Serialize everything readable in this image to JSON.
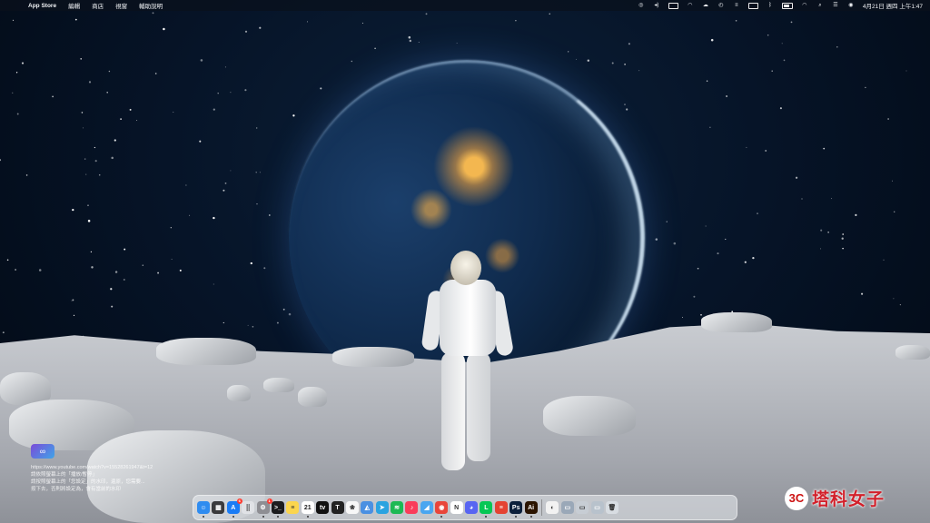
{
  "menubar": {
    "app_name": "App Store",
    "menus": [
      "編輯",
      "商店",
      "視窗",
      "輔助說明"
    ],
    "status_icons": [
      "ring-icon",
      "volume-icon",
      "display-icon",
      "headphones-icon",
      "cloud-icon",
      "timer-icon",
      "menu-icon",
      "battery-info-icon",
      "bluetooth-icon",
      "wifi-icon",
      "control-center-icon",
      "user-icon"
    ],
    "datetime": "4月21日 週四 上午1:47"
  },
  "notice": {
    "lines": [
      "https://www.youtube.com/watch?v=15528261947&t=12",
      "請依照螢幕上的「播放/暫停」",
      "請按照螢幕上的「您設定」的水印，還原，您需要...",
      "按下去，否則將設定為，會有當前的水印"
    ]
  },
  "dock": {
    "items": [
      {
        "name": "finder",
        "glyph": "☺",
        "color": "#2f8cf0"
      },
      {
        "name": "calculator",
        "glyph": "▦",
        "color": "#3a3a3c"
      },
      {
        "name": "app-store",
        "glyph": "A",
        "color": "#1a7cf5",
        "badge": "6"
      },
      {
        "name": "launchpad",
        "glyph": "⣿",
        "color": "#e0e2e6"
      },
      {
        "name": "system-preferences",
        "glyph": "⚙",
        "color": "#8e8e93",
        "badge": "1"
      },
      {
        "name": "terminal",
        "glyph": ">_",
        "color": "#1c1c1e"
      },
      {
        "name": "notes",
        "glyph": "≡",
        "color": "#fbd54e"
      },
      {
        "name": "calendar",
        "glyph": "21",
        "color": "#ffffff"
      },
      {
        "name": "apple-tv",
        "glyph": "tv",
        "color": "#111111"
      },
      {
        "name": "stocks-app",
        "glyph": "T",
        "color": "#222222"
      },
      {
        "name": "photos",
        "glyph": "❀",
        "color": "#f7f7f7"
      },
      {
        "name": "safari-alt",
        "glyph": "◭",
        "color": "#4a90e2"
      },
      {
        "name": "telegram",
        "glyph": "➤",
        "color": "#2aa3e0"
      },
      {
        "name": "spotify",
        "glyph": "≋",
        "color": "#1db954"
      },
      {
        "name": "music",
        "glyph": "♪",
        "color": "#fa3c5a"
      },
      {
        "name": "maps",
        "glyph": "◢",
        "color": "#4aa6f0"
      },
      {
        "name": "chrome",
        "glyph": "◉",
        "color": "#e9453a"
      },
      {
        "name": "notion",
        "glyph": "N",
        "color": "#ffffff"
      },
      {
        "name": "discord",
        "glyph": "◕",
        "color": "#5865f2"
      },
      {
        "name": "line",
        "glyph": "L",
        "color": "#06c755"
      },
      {
        "name": "todoist",
        "glyph": "≡",
        "color": "#e44332"
      },
      {
        "name": "photoshop",
        "glyph": "Ps",
        "color": "#0b1f3a"
      },
      {
        "name": "illustrator",
        "glyph": "Ai",
        "color": "#2b1400"
      },
      {
        "name": "screenshot",
        "glyph": "◐",
        "color": "#f2f2f2"
      },
      {
        "name": "downloads-stack",
        "glyph": "▭",
        "color": "#9aa8b8"
      },
      {
        "name": "documents-stack",
        "glyph": "▭",
        "color": "#c7cdd4"
      },
      {
        "name": "window-stack",
        "glyph": "▭",
        "color": "#b8c2cc"
      },
      {
        "name": "trash",
        "glyph": "🗑",
        "color": "#d8dde2"
      }
    ]
  },
  "watermark": {
    "badge": "3C",
    "text": "塔科女子"
  }
}
